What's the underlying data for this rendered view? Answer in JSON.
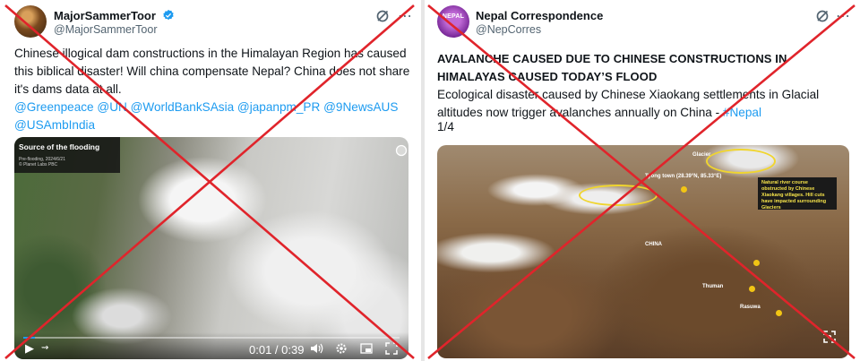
{
  "left_post": {
    "display_name": "MajorSammerToor",
    "handle": "@MajorSammerToor",
    "verified": true,
    "text": "Chinese illogical dam constructions in the Himalayan Region has caused this biblical disaster! Will china compensate Nepal? China does not share it's dams data at all.",
    "mentions": "@Greenpeace @UN @WorldBankSAsia @japanpm_PR @9NewsAUS @USAmbIndia",
    "media": {
      "tag_title": "Source of the flooding",
      "tag_sub_1": "Pre-flooding, 2024/6/21",
      "tag_sub_2": "© Planet Labs PBC",
      "video_time": "0:01 / 0:39",
      "progress_fraction": 0.03
    },
    "icons": [
      "grok-icon",
      "more-icon",
      "play-icon",
      "forward-icon",
      "volume-icon",
      "settings-icon",
      "picture-in-picture-icon",
      "fullscreen-icon"
    ]
  },
  "right_post": {
    "display_name": "Nepal Correspondence",
    "handle": "@NepCorres",
    "avatar_text": "NEPAL",
    "headline": "AVALANCHE CAUSED DUE TO CHINESE CONSTRUCTIONS IN HIMALAYAS CAUSED TODAY’S FLOOD",
    "text": "Ecological disaster caused by Chinese Xiaokang settlements in Glacial altitudes now trigger avalanches annually on China -",
    "hashtag": "#Nepal",
    "counter": "1/4",
    "map_labels": {
      "glacier": "Glacier",
      "town": "Tyong town (28.39°N, 85.33°E)",
      "china": "CHINA",
      "thuman": "Thuman",
      "rasuwa": "Rasuwa",
      "callout": "Natural river course obstructed by Chinese Xiaokang villages. Hill cuts have impacted surrounding Glaciers"
    }
  },
  "colors": {
    "link": "#1d9bf0",
    "cross": "#e0242b",
    "verified": "#1d9bf0"
  }
}
